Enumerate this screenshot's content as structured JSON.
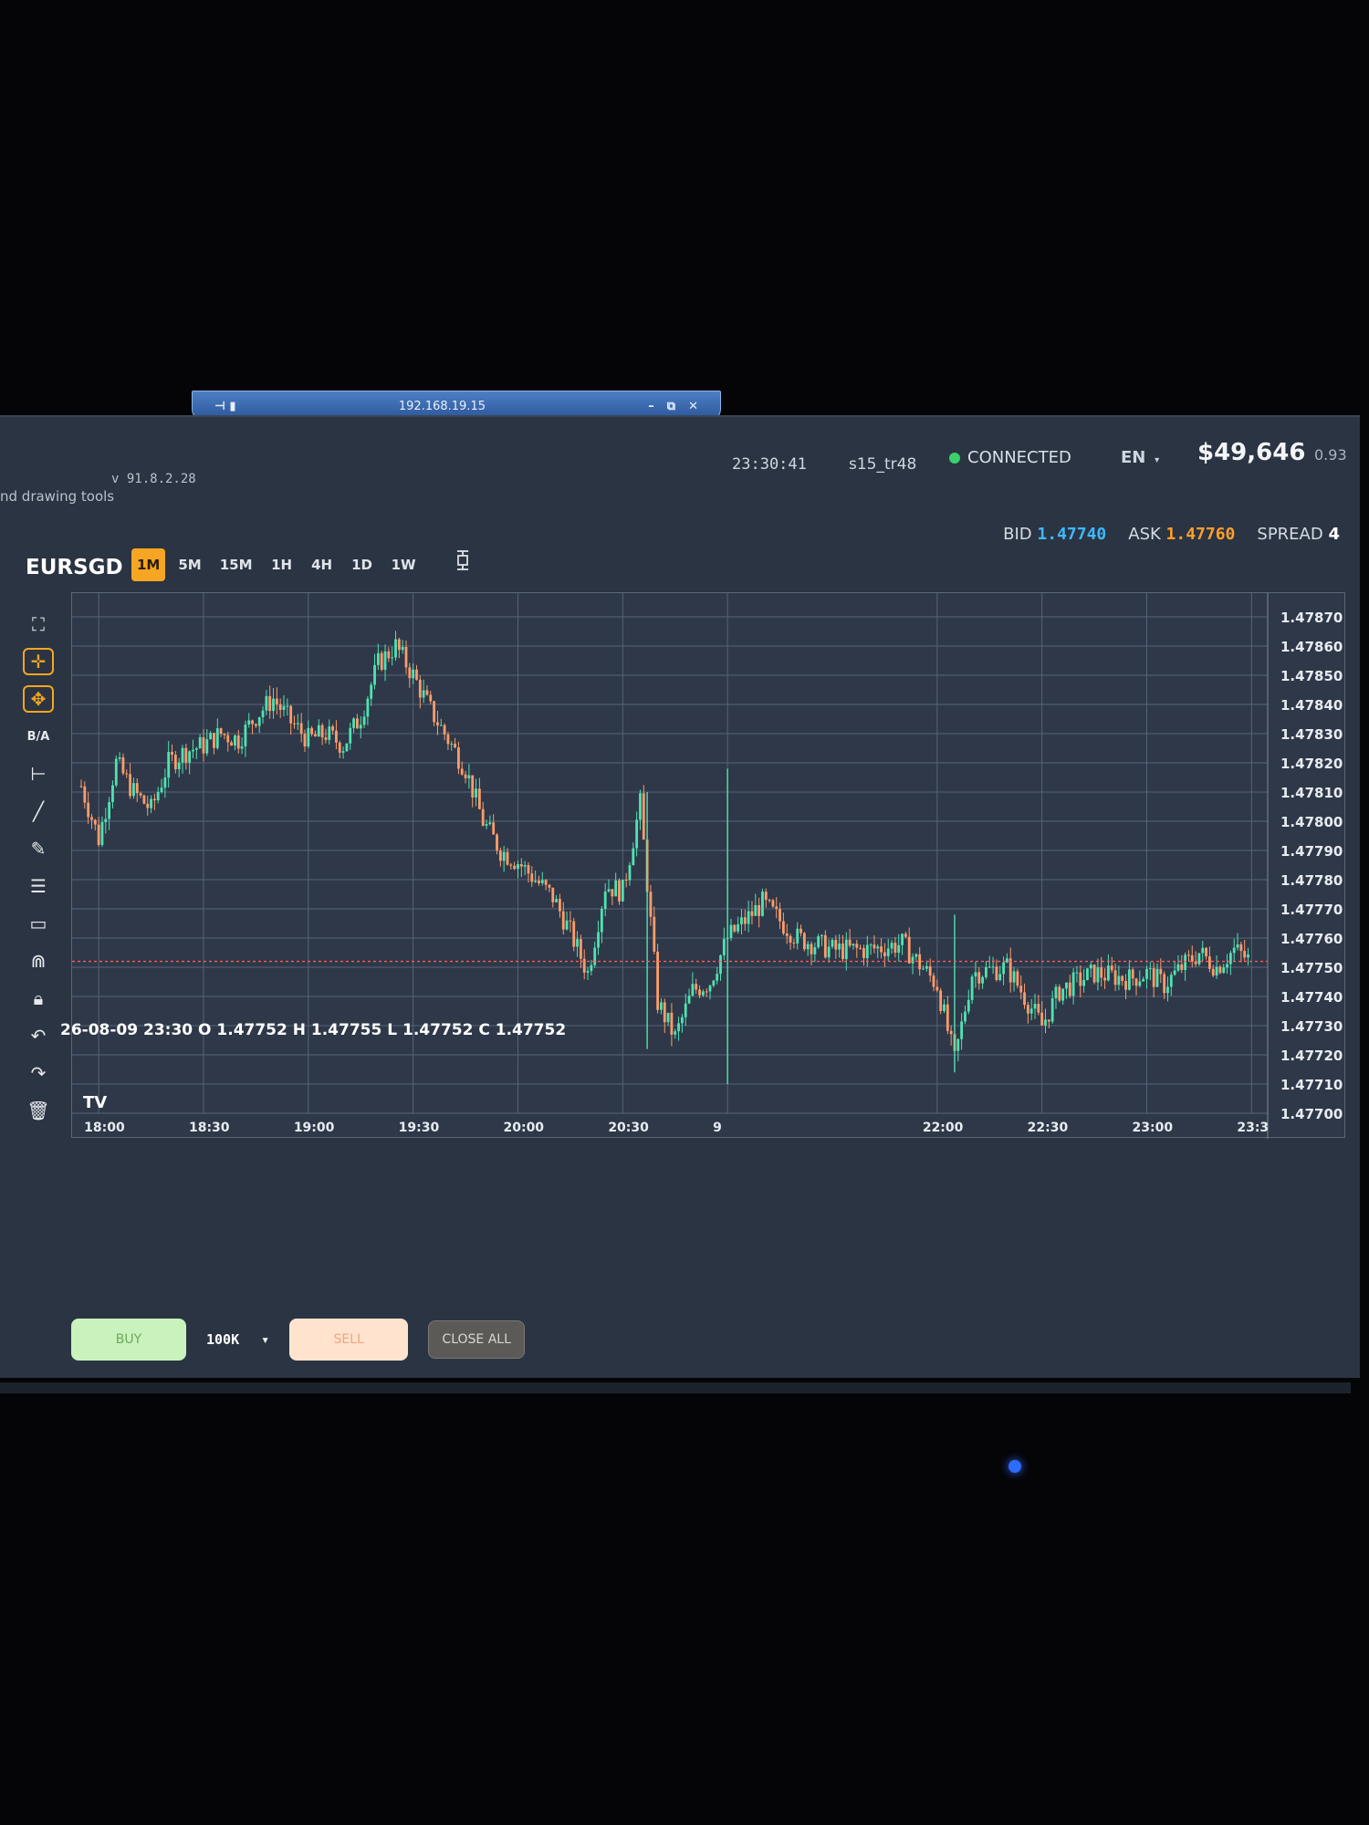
{
  "remote": {
    "ip": "192.168.19.15"
  },
  "header": {
    "version": "v 91.8.2.28",
    "tools_hint": "nd drawing tools",
    "clock": "23:30:41",
    "user": "s15_tr48",
    "status": "CONNECTED",
    "language": "EN",
    "balance": "$49,646",
    "balance_fraction": "0.93"
  },
  "quote": {
    "bid_label": "BID",
    "bid": "1.47740",
    "ask_label": "ASK",
    "ask": "1.47760",
    "spread_label": "SPREAD",
    "spread": "4"
  },
  "symbol": "EURSGD",
  "timeframes": [
    "1M",
    "5M",
    "15M",
    "1H",
    "4H",
    "1D",
    "1W"
  ],
  "active_timeframe": "1M",
  "toolbar": {
    "bid_ask_label": "B/A"
  },
  "trade": {
    "buy_label": "BUY",
    "quantity": "100K",
    "sell_label": "SELL",
    "close_all_label": "CLOSE ALL"
  },
  "colors": {
    "up": "#4fe3b2",
    "down": "#ff9c6b",
    "price_line": "#ff5a5a",
    "accent": "#f6a623"
  },
  "chart_data": {
    "type": "candlestick",
    "ohlc_legend": "26-08-09 23:30 O 1.47752 H 1.47755 L 1.47752 C 1.47752",
    "y_ticks": [
      "1.47870",
      "1.47860",
      "1.47850",
      "1.47840",
      "1.47830",
      "1.47820",
      "1.47810",
      "1.47800",
      "1.47790",
      "1.47780",
      "1.47770",
      "1.47760",
      "1.47750",
      "1.47740",
      "1.47730",
      "1.47720",
      "1.47710",
      "1.47700"
    ],
    "ylim": [
      1.477,
      1.47875
    ],
    "x_ticks": [
      "18:00",
      "18:30",
      "19:00",
      "19:30",
      "20:00",
      "20:30",
      "9",
      "22:00",
      "22:30",
      "23:00",
      "23:3"
    ],
    "current_price": 1.47752,
    "close_path": [
      [
        "17:55",
        1.47812
      ],
      [
        "18:00",
        1.47794
      ],
      [
        "18:05",
        1.4782
      ],
      [
        "18:10",
        1.4781
      ],
      [
        "18:15",
        1.47804
      ],
      [
        "18:20",
        1.4782
      ],
      [
        "18:25",
        1.47824
      ],
      [
        "18:30",
        1.47826
      ],
      [
        "18:35",
        1.4783
      ],
      [
        "18:40",
        1.47828
      ],
      [
        "18:45",
        1.47836
      ],
      [
        "18:50",
        1.47842
      ],
      [
        "18:55",
        1.47834
      ],
      [
        "19:00",
        1.47828
      ],
      [
        "19:05",
        1.4783
      ],
      [
        "19:10",
        1.47826
      ],
      [
        "19:15",
        1.47836
      ],
      [
        "19:20",
        1.47854
      ],
      [
        "19:25",
        1.4786
      ],
      [
        "19:30",
        1.4785
      ],
      [
        "19:35",
        1.47838
      ],
      [
        "19:40",
        1.47828
      ],
      [
        "19:45",
        1.47818
      ],
      [
        "19:50",
        1.478
      ],
      [
        "19:55",
        1.4779
      ],
      [
        "20:00",
        1.47786
      ],
      [
        "20:05",
        1.4778
      ],
      [
        "20:10",
        1.47774
      ],
      [
        "20:15",
        1.47762
      ],
      [
        "20:20",
        1.47748
      ],
      [
        "20:25",
        1.47778
      ],
      [
        "20:30",
        1.47776
      ],
      [
        "20:35",
        1.47806
      ],
      [
        "20:40",
        1.47738
      ],
      [
        "20:45",
        1.47726
      ],
      [
        "20:50",
        1.47742
      ],
      [
        "20:55",
        1.47745
      ],
      [
        "21:00",
        1.4776
      ],
      [
        "21:10",
        1.47772
      ],
      [
        "21:20",
        1.4776
      ],
      [
        "21:30",
        1.47756
      ],
      [
        "21:40",
        1.47756
      ],
      [
        "21:50",
        1.47758
      ],
      [
        "22:00",
        1.47744
      ],
      [
        "22:05",
        1.47718
      ],
      [
        "22:10",
        1.47748
      ],
      [
        "22:20",
        1.4775
      ],
      [
        "22:25",
        1.4774
      ],
      [
        "22:30",
        1.4773
      ],
      [
        "22:35",
        1.47742
      ],
      [
        "22:45",
        1.47748
      ],
      [
        "22:55",
        1.47746
      ],
      [
        "23:00",
        1.47748
      ],
      [
        "23:05",
        1.47744
      ],
      [
        "23:10",
        1.4775
      ],
      [
        "23:15",
        1.47755
      ],
      [
        "23:20",
        1.4775
      ],
      [
        "23:25",
        1.47756
      ],
      [
        "23:30",
        1.47752
      ]
    ]
  }
}
